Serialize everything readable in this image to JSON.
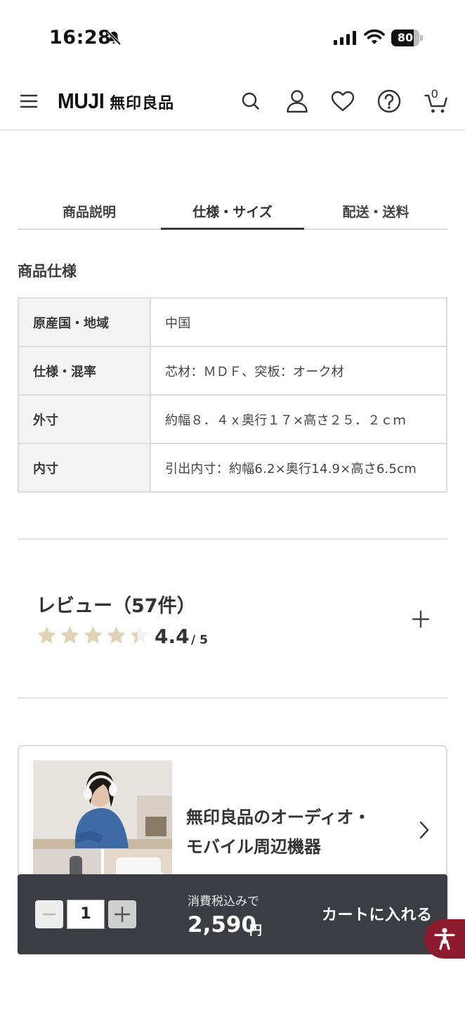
{
  "status_bar": {
    "time": "16:28",
    "battery": "80",
    "battery_level": 0.8
  },
  "header": {
    "logo_latin": "MUJI",
    "logo_kanji": "無印良品",
    "cart_count": "0"
  },
  "tabs": [
    {
      "label": "商品説明",
      "active": false
    },
    {
      "label": "仕様・サイズ",
      "active": true
    },
    {
      "label": "配送・送料",
      "active": false
    }
  ],
  "specs": {
    "title": "商品仕様",
    "rows": [
      {
        "key": "原産国・地域",
        "value": "中国"
      },
      {
        "key": "仕様・混率",
        "value": "芯材：ＭＤＦ、突板：オーク材"
      },
      {
        "key": "外寸",
        "value": "約幅８．４ｘ奥行１７×高さ２５．２ｃｍ"
      },
      {
        "key": "内寸",
        "value": "引出内寸：約幅6.2×奥行14.9×高さ6.5cm"
      }
    ]
  },
  "review": {
    "title": "レビュー（57件）",
    "rating": "4.4",
    "rating_max": "/ 5",
    "rating_value": 4.4,
    "star_color": "#e0d2b4"
  },
  "banner": {
    "line1": "無印良品のオーディオ・",
    "line2": "モバイル周辺機器"
  },
  "cart_bar": {
    "quantity": "1",
    "tax_label": "消費税込みで",
    "price": "2,590",
    "currency": "円",
    "add_to_cart": "カートに入れる"
  },
  "colors": {
    "accent": "#8c1c2d",
    "bar": "#3c3c44"
  }
}
